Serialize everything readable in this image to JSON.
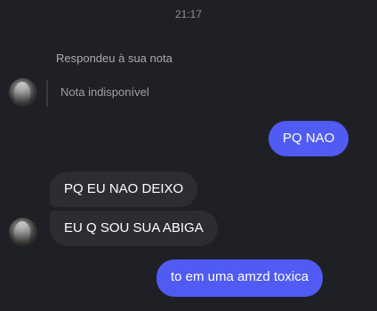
{
  "timestamp": "21:17",
  "reply_context": "Respondeu à sua nota",
  "note": {
    "text": "Nota indisponível"
  },
  "messages": [
    {
      "direction": "sent",
      "text": "PQ NAO"
    },
    {
      "direction": "received",
      "text": "PQ EU NAO DEIXO"
    },
    {
      "direction": "received",
      "text": "EU Q SOU SUA ABIGA"
    },
    {
      "direction": "sent",
      "text": "to em uma amzd toxica"
    }
  ],
  "colors": {
    "background": "#1f2026",
    "sent_bubble": "#4f5bf2",
    "received_bubble": "#2c2d33"
  }
}
